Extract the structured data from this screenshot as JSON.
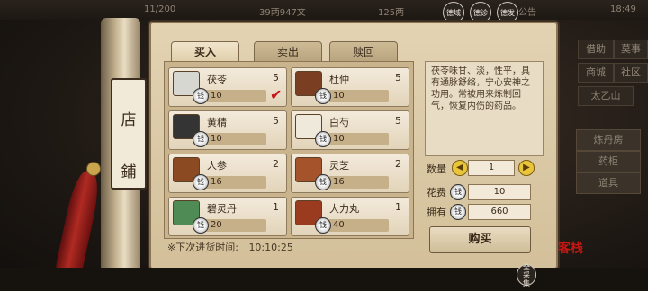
{
  "status_bar": {
    "energy": "11/200",
    "money": "39两947文",
    "other": "125两",
    "announce": "公告",
    "time": "18:49"
  },
  "quick_buttons": [
    "德域",
    "德诊",
    "德发"
  ],
  "right_menu": {
    "row1": [
      "借助",
      "莫事"
    ],
    "row2": [
      "商城",
      "社区"
    ],
    "location": "太乙山",
    "tabs": [
      "炼丹房",
      "药柜",
      "道具"
    ]
  },
  "scroll": {
    "chars": [
      "店",
      "鋪"
    ]
  },
  "tabs": [
    "买入",
    "卖出",
    "赎回"
  ],
  "items": [
    {
      "name": "茯苓",
      "count": "5",
      "price": "10"
    },
    {
      "name": "杜仲",
      "count": "5",
      "price": "10"
    },
    {
      "name": "黄精",
      "count": "5",
      "price": "10"
    },
    {
      "name": "白芍",
      "count": "5",
      "price": "10"
    },
    {
      "name": "人参",
      "count": "2",
      "price": "16"
    },
    {
      "name": "灵芝",
      "count": "2",
      "price": "16"
    },
    {
      "name": "碧灵丹",
      "count": "1",
      "price": "20"
    },
    {
      "name": "大力丸",
      "count": "1",
      "price": "40"
    }
  ],
  "description": "茯苓味甘、淡，性平，具有通脉舒络，宁心安神之功用。常被用来炼制回气，恢复内伤的药品。",
  "purchase": {
    "qty_label": "数量",
    "qty": "1",
    "cost_label": "花费",
    "cost": "10",
    "own_label": "拥有",
    "own": "660",
    "buy": "购买"
  },
  "restock": {
    "label": "※下次进货时间:",
    "time": "10:10:25"
  },
  "seal": "客栈",
  "collect": "全采集"
}
